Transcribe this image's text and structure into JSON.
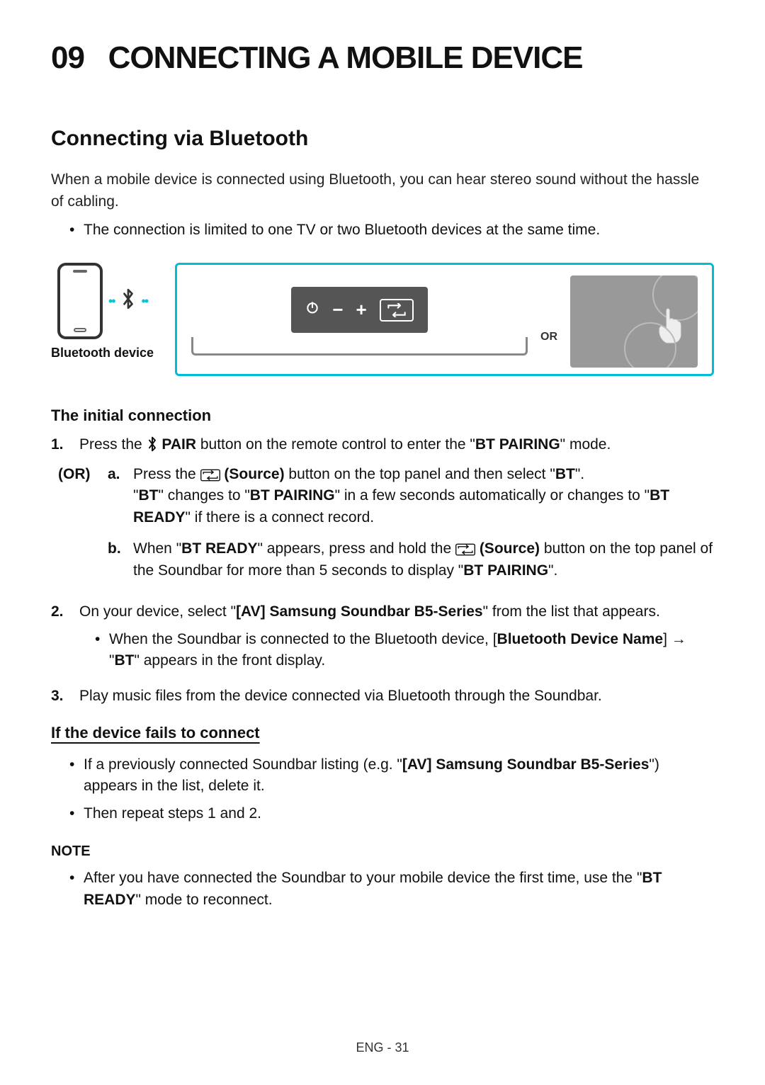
{
  "chapter": {
    "number": "09",
    "title": "CONNECTING A MOBILE DEVICE"
  },
  "section": {
    "title": "Connecting via Bluetooth",
    "intro": "When a mobile device is connected using Bluetooth, you can hear stereo sound without the hassle of cabling.",
    "limit_bullet": "The connection is limited to one TV or two Bluetooth devices at the same time."
  },
  "diagram": {
    "bt_caption": "Bluetooth device",
    "or_label": "OR"
  },
  "initial": {
    "heading": "The initial connection",
    "step1_pre": "Press the ",
    "pair_label": " PAIR",
    "step1_post": " button on the remote control to enter the \"",
    "bt_pairing": "BT PAIRING",
    "step1_end": "\" mode.",
    "or_label": "(OR)",
    "a_pre": "Press the ",
    "source_label": " (Source)",
    "a_mid": " button on the top panel and then select \"",
    "bt": "BT",
    "a_end": "\".",
    "a_line2_pre": "\"",
    "a_line2_mid1": "\" changes to \"",
    "a_line2_mid2": "\" in a few seconds automatically or changes to \"",
    "bt_ready": "BT READY",
    "a_line2_end": "\" if there is a connect record.",
    "b_pre": "When \"",
    "b_mid1": "\" appears, press and hold the ",
    "b_mid2": " button on the top panel of the Soundbar for more than 5 seconds to display \"",
    "b_end": "\".",
    "step2_pre": "On your device, select \"",
    "device_name": "[AV] Samsung Soundbar B5-Series",
    "step2_post": "\" from the list that appears.",
    "step2_bullet_pre": "When the Soundbar is connected to the Bluetooth device, [",
    "bdn": "Bluetooth Device Name",
    "step2_bullet_mid": "] → \"",
    "step2_bullet_end": "\" appears in the front display.",
    "step3": "Play music files from the device connected via Bluetooth through the Soundbar."
  },
  "fails": {
    "heading": "If the device fails to connect",
    "b1_pre": "If a previously connected Soundbar listing (e.g. \"",
    "b1_post": "\") appears in the list, delete it.",
    "b2": "Then repeat steps 1 and 2."
  },
  "note": {
    "heading": "NOTE",
    "b1_pre": "After you have connected the Soundbar to your mobile device the first time, use the \"",
    "b1_post": "\" mode to reconnect."
  },
  "footer": {
    "lang": "ENG",
    "sep": " - ",
    "page": "31"
  }
}
